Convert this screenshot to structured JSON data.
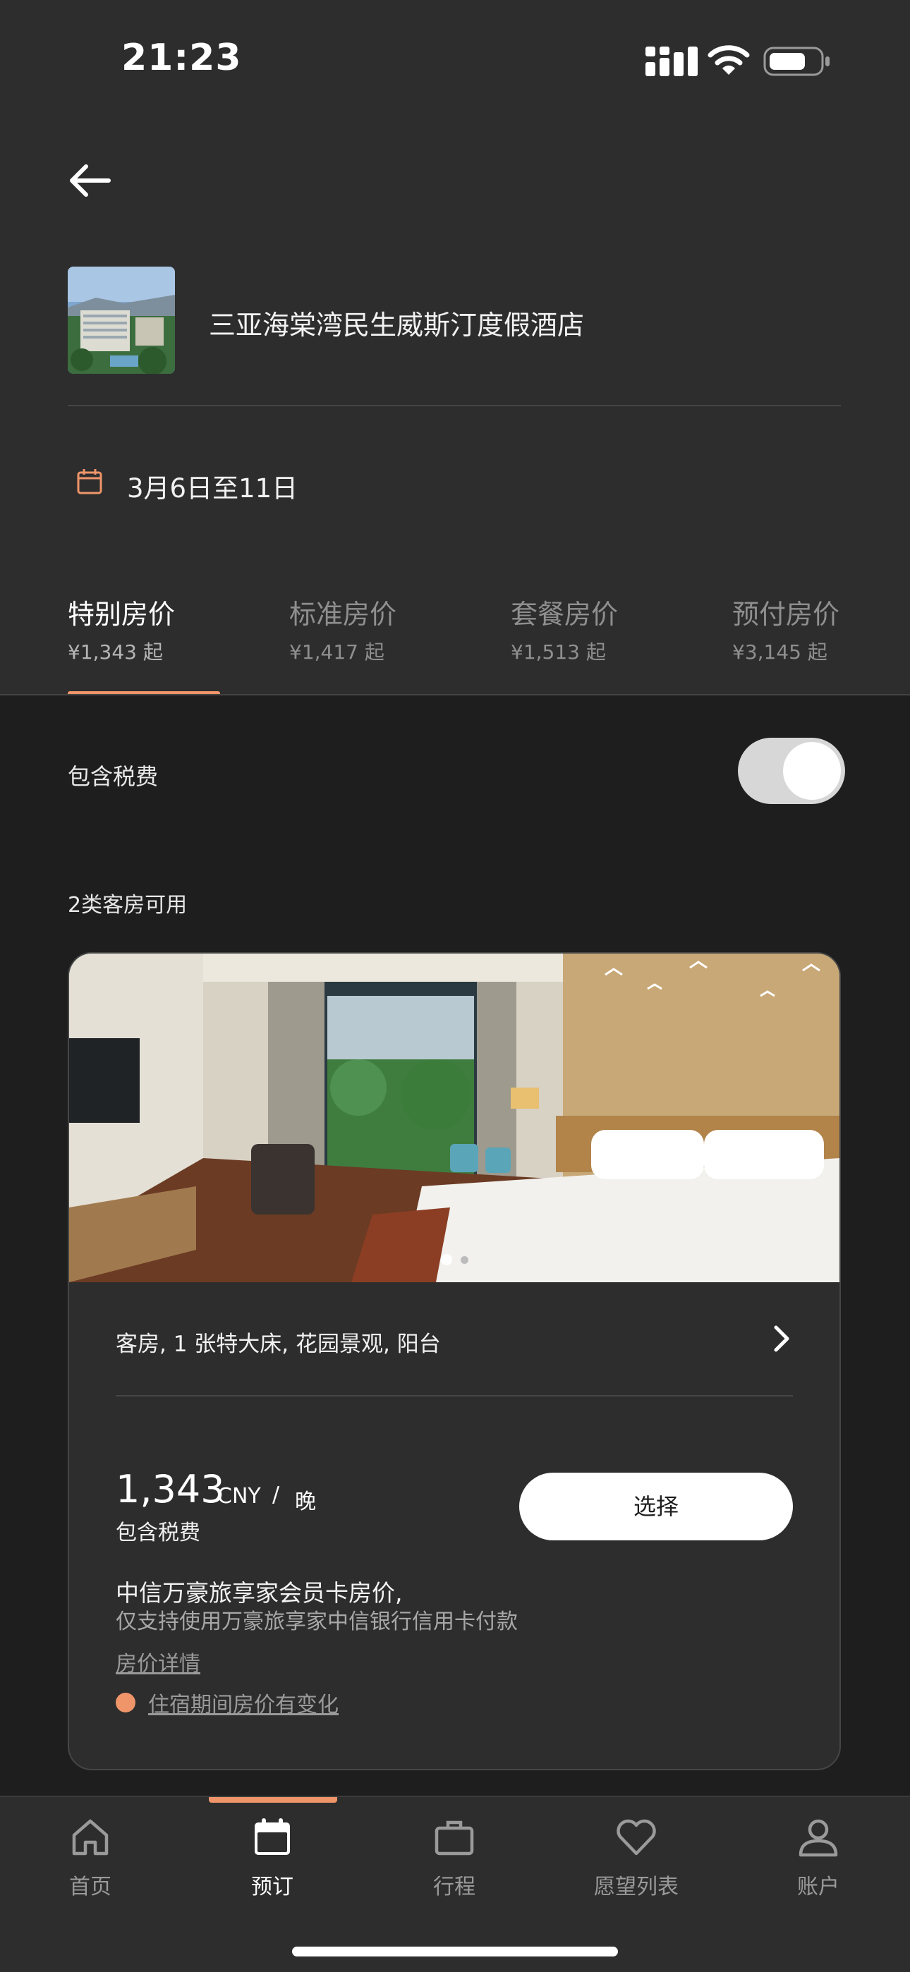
{
  "status_bar": {
    "time": "21:23"
  },
  "header": {
    "hotel_name": "三亚海棠湾民生威斯汀度假酒店",
    "dates": "3月6日至11日"
  },
  "rate_tabs": [
    {
      "label": "特别房价",
      "price": "¥1,343 起",
      "active": true
    },
    {
      "label": "标准房价",
      "price": "¥1,417 起",
      "active": false
    },
    {
      "label": "套餐房价",
      "price": "¥1,513 起",
      "active": false
    },
    {
      "label": "预付房价",
      "price": "¥3,145 起",
      "active": false
    }
  ],
  "tax_toggle": {
    "label": "包含税费",
    "on": true
  },
  "rooms_available": "2类客房可用",
  "room": {
    "title": "客房, 1 张特大床, 花园景观, 阳台",
    "photo_count": 2,
    "photo_index": 1,
    "price": "1,343",
    "currency": "CNY",
    "separator": "/",
    "per": "晚",
    "tax_note": "包含税费",
    "select_label": "选择",
    "promo_title": "中信万豪旅享家会员卡房价,",
    "promo_subtitle": "仅支持使用万豪旅享家中信银行信用卡付款",
    "rate_details": "房价详情",
    "price_change": "住宿期间房价有变化"
  },
  "bottom_nav": [
    {
      "label": "首页",
      "icon": "home-icon",
      "active": false
    },
    {
      "label": "预订",
      "icon": "calendar-icon",
      "active": true
    },
    {
      "label": "行程",
      "icon": "briefcase-icon",
      "active": false
    },
    {
      "label": "愿望列表",
      "icon": "heart-icon",
      "active": false
    },
    {
      "label": "账户",
      "icon": "person-icon",
      "active": false
    }
  ],
  "colors": {
    "accent": "#f0956a",
    "background": "#1e1e1e",
    "surface": "#2d2d2d"
  }
}
